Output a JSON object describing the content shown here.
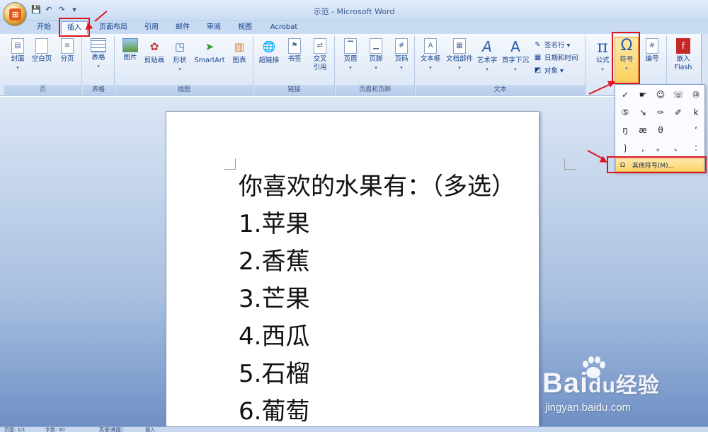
{
  "window": {
    "title": "示范 - Microsoft Word"
  },
  "qat": {
    "save": "💾",
    "undo": "↶",
    "redo": "↷",
    "dropdown": "▾"
  },
  "tabs": [
    "开始",
    "插入",
    "页面布局",
    "引用",
    "邮件",
    "审阅",
    "视图",
    "Acrobat"
  ],
  "active_tab": "插入",
  "ribbon": {
    "groups": {
      "pages": {
        "label": "页",
        "buttons": [
          "封面",
          "空白页",
          "分页"
        ]
      },
      "tables": {
        "label": "表格",
        "buttons": [
          "表格"
        ]
      },
      "illustrations": {
        "label": "插图",
        "buttons": [
          "图片",
          "剪贴画",
          "形状",
          "SmartArt",
          "图表"
        ]
      },
      "links": {
        "label": "链接",
        "buttons": [
          "超链接",
          "书签",
          "交叉",
          "引用"
        ]
      },
      "header_footer": {
        "label": "页眉和页脚",
        "buttons": [
          "页眉",
          "页脚",
          "页码"
        ]
      },
      "text": {
        "label": "文本",
        "buttons": [
          "文本框",
          "文档部件",
          "艺术字",
          "首字下沉"
        ],
        "small": [
          "签名行 ▾",
          "日期和时间",
          "对象 ▾"
        ]
      },
      "symbols": {
        "buttons": [
          "公式",
          "符号",
          "编号"
        ]
      },
      "flash": {
        "buttons": [
          "嵌入",
          "Flash"
        ]
      }
    }
  },
  "symbol_menu": {
    "symbols": [
      "✓",
      "☛",
      "☺",
      "☏",
      "⑩",
      "⑤",
      "↘",
      "✑",
      "✐",
      "k",
      "ŋ",
      "æ",
      "θ",
      "ʻ",
      "",
      "❳",
      ",",
      "。",
      "、",
      ":"
    ],
    "more_label": "其他符号(M)...",
    "more_icon": "Ω"
  },
  "document": {
    "lines": [
      "你喜欢的水果有：（多选）",
      "1.苹果",
      "2.香蕉",
      "3.芒果",
      "4.西瓜",
      "5.石榴",
      "6.葡萄"
    ]
  },
  "statusbar": {
    "page": "页面: 1/1",
    "words": "字数: 30",
    "lang": "英语(美国)",
    "insert": "插入"
  },
  "watermark": {
    "brand": "Bai",
    "brand2": "du",
    "brand3": "经验",
    "url": "jingyan.baidu.com"
  },
  "colors": {
    "highlight": "#e0141e",
    "ribbon_bg": "#dfe9f7"
  }
}
